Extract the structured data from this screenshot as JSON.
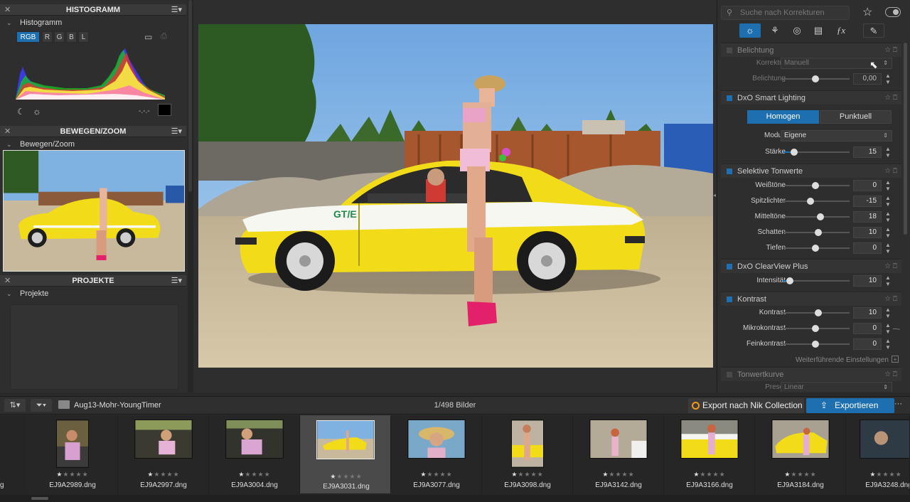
{
  "left": {
    "histogram_header": "HISTOGRAMM",
    "histogram_sub": "Histogramm",
    "channels": [
      "RGB",
      "R",
      "G",
      "B",
      "L"
    ],
    "clip_value": "-.-.-",
    "movezoom_header": "BEWEGEN/ZOOM",
    "movezoom_sub": "Bewegen/Zoom",
    "projects_header": "PROJEKTE",
    "projects_sub": "Projekte"
  },
  "right": {
    "search_placeholder": "Suche nach Korrekturen",
    "sections": {
      "exposure": {
        "title": "Belichtung",
        "korrektur_label": "Korrektur",
        "korrektur_value": "Manuell",
        "belichtung_label": "Belichtung",
        "belichtung_value": "0,00"
      },
      "smart_lighting": {
        "title": "DxO Smart Lighting",
        "mode_homogen": "Homogen",
        "mode_punktuell": "Punktuell",
        "modus_label": "Modus",
        "modus_value": "Eigene",
        "staerke_label": "Stärke",
        "staerke_value": "15"
      },
      "selective_tones": {
        "title": "Selektive Tonwerte",
        "rows": [
          {
            "label": "Weißtöne",
            "value": "0"
          },
          {
            "label": "Spitzlichter",
            "value": "-15"
          },
          {
            "label": "Mitteltöne",
            "value": "18"
          },
          {
            "label": "Schatten",
            "value": "10"
          },
          {
            "label": "Tiefen",
            "value": "0"
          }
        ]
      },
      "clearview": {
        "title": "DxO ClearView Plus",
        "label": "Intensität",
        "value": "10"
      },
      "contrast": {
        "title": "Kontrast",
        "rows": [
          {
            "label": "Kontrast",
            "value": "10"
          },
          {
            "label": "Mikrokontrast",
            "value": "0"
          },
          {
            "label": "Feinkontrast",
            "value": "0"
          }
        ],
        "advanced_link": "Weiterführende Einstellungen"
      },
      "tone_curve": {
        "title": "Tonwertkurve",
        "preset_label": "Preset",
        "preset_value": "Linear"
      }
    }
  },
  "bar": {
    "folder_name": "Aug13-Mohr-YoungTimer",
    "count": "1/498 Bilder",
    "nik_label": "Export nach Nik Collection",
    "export_label": "Exportieren",
    "more_label": "···"
  },
  "filmstrip": [
    {
      "name": "EJ9A2989.dng",
      "rating": 1
    },
    {
      "name": "EJ9A2997.dng",
      "rating": 1
    },
    {
      "name": "EJ9A3004.dng",
      "rating": 1
    },
    {
      "name": "EJ9A3031.dng",
      "rating": 1,
      "selected": true
    },
    {
      "name": "EJ9A3077.dng",
      "rating": 1
    },
    {
      "name": "EJ9A3098.dng",
      "rating": 1
    },
    {
      "name": "EJ9A3142.dng",
      "rating": 1
    },
    {
      "name": "EJ9A3166.dng",
      "rating": 1
    },
    {
      "name": "EJ9A3184.dng",
      "rating": 1
    },
    {
      "name": "EJ9A3248.dng",
      "rating": 1
    }
  ],
  "colors": {
    "accent": "#1d6fb0",
    "panel": "#2e2e2e",
    "car_yellow": "#f2dc1a"
  }
}
